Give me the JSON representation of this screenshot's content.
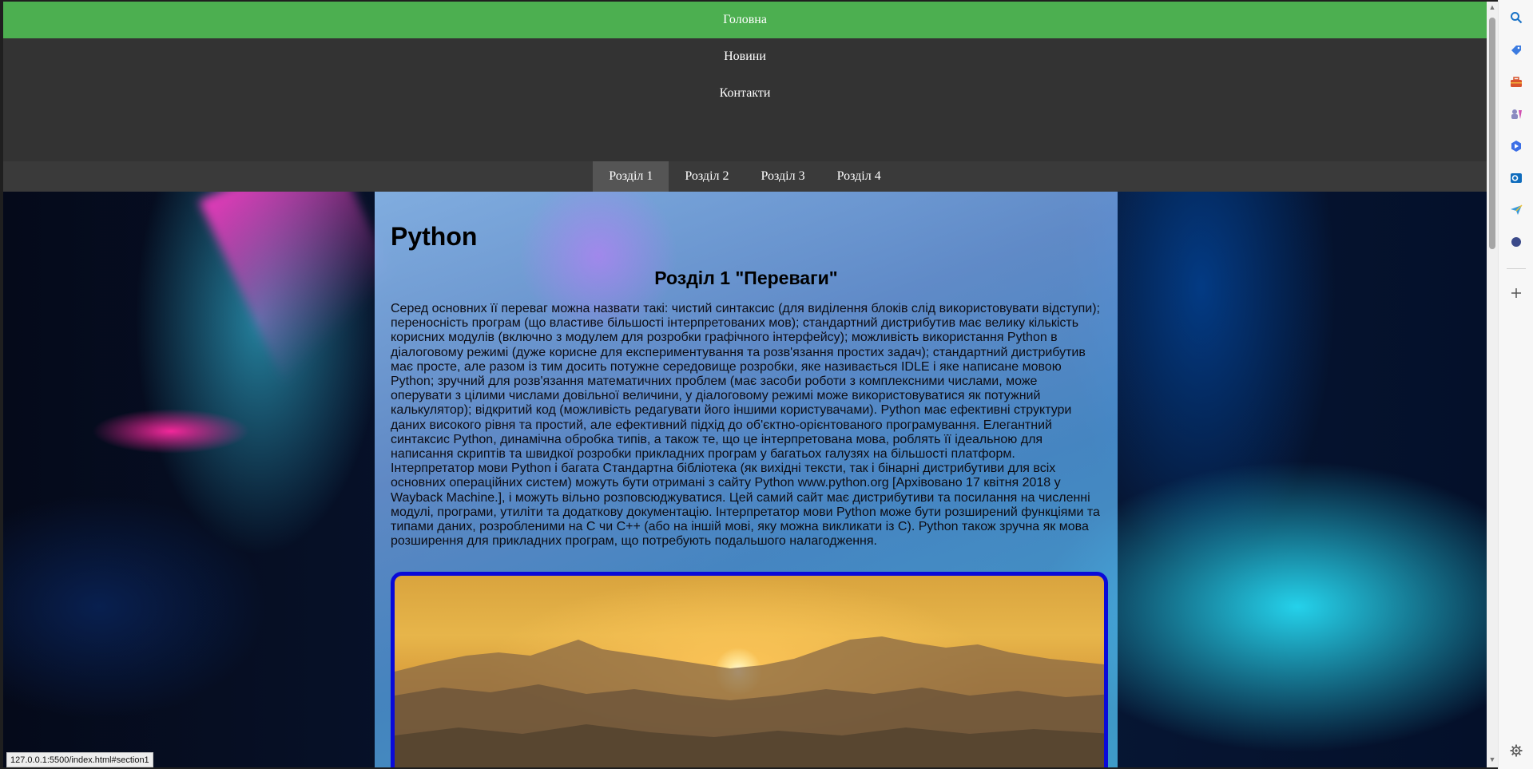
{
  "topnav": {
    "items": [
      "Головна",
      "Новини",
      "Контакти"
    ],
    "active_index": 0
  },
  "tabs": {
    "items": [
      "Розділ 1",
      "Розділ 2",
      "Розділ 3",
      "Розділ 4"
    ],
    "active_index": 0
  },
  "content": {
    "site_title": "Python",
    "section_title": "Розділ 1 \"Переваги\"",
    "section_text": "Серед основних її переваг можна назвати такі: чистий синтаксис (для виділення блоків слід використовувати відступи); переносність програм (що властиве більшості інтерпретованих мов); стандартний дистрибутив має велику кількість корисних модулів (включно з модулем для розробки графічного інтерфейсу); можливість використання Python в діалоговому режимі (дуже корисне для експериментування та розв'язання простих задач); стандартний дистрибутив має просте, але разом із тим досить потужне середовище розробки, яке називається IDLE і яке написане мовою Python; зручний для розв'язання математичних проблем (має засоби роботи з комплексними числами, може оперувати з цілими числами довільної величини, у діалоговому режимі може використовуватися як потужний калькулятор); відкритий код (можливість редагувати його іншими користувачами). Python має ефективні структури даних високого рівня та простий, але ефективний підхід до об'єктно-орієнтованого програмування. Елегантний синтаксис Python, динамічна обробка типів, а також те, що це інтерпретована мова, роблять її ідеальною для написання скриптів та швидкої розробки прикладних програм у багатьох галузях на більшості платформ. Інтерпретатор мови Python і багата Стандартна бібліотека (як вихідні тексти, так і бінарні дистрибутиви для всіх основних операційних систем) можуть бути отримані з сайту Python www.python.org [Архівовано 17 квітня 2018 у Wayback Machine.], і можуть вільно розповсюджуватися. Цей самий сайт має дистрибутиви та посилання на численні модулі, програми, утиліти та додаткову документацію. Інтерпретатор мови Python може бути розширений функціями та типами даних, розробленими на C чи C++ (або на іншій мові, яку можна викликати із C). Python також зручна як мова розширення для прикладних програм, що потребують подальшого налагодження."
  },
  "status_bar": {
    "url": "127.0.0.1:5500/index.html#section1"
  },
  "sidebar_icons": [
    "search-icon",
    "tag-icon",
    "toolbox-icon",
    "games-icon",
    "copilot-icon",
    "outlook-icon",
    "send-icon",
    "circle-icon",
    "add-icon",
    "settings-icon"
  ],
  "colors": {
    "nav_bg": "#333333",
    "nav_active": "#4caf50",
    "tab_active": "#555555",
    "photo_border": "#0a0ad8"
  }
}
